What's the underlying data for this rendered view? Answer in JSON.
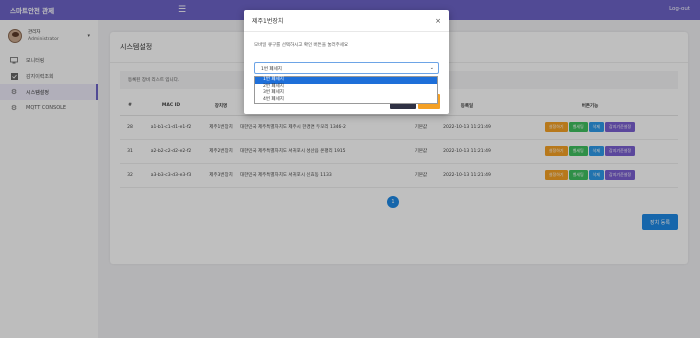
{
  "app": {
    "brand": "스마트안전 관제",
    "logout": "Log-out"
  },
  "user": {
    "name": "관리자",
    "role": "Administrator"
  },
  "sidebar": {
    "items": [
      {
        "label": "모니터링",
        "icon": "monitor-icon"
      },
      {
        "label": "감지이력조회",
        "icon": "checklist-icon"
      },
      {
        "label": "시스템설정",
        "icon": "gear-icon"
      },
      {
        "label": "MQTT CONSOLE",
        "icon": "gear-icon"
      }
    ]
  },
  "page": {
    "title": "시스템설정",
    "notice": "등록된 장비 리스트 입니다.",
    "headers": [
      "#",
      "MAC ID",
      "장치명",
      "",
      "등록일",
      "버튼기능"
    ],
    "rows": [
      {
        "num": "28",
        "mac": "a1-b1-c1-d1-e1-f2",
        "name": "제주1번장치",
        "addr": "대한민국 제주특별자치도 제주시 한경면 두모리 1346-2",
        "type": "기본값",
        "date": "2022-10-13 11:21:49"
      },
      {
        "num": "31",
        "mac": "a2-b2-c2-d2-e2-f2",
        "name": "제주2번장치",
        "addr": "대한민국 제주특별자치도 서귀포시 성산읍 온평리 1915",
        "type": "기본값",
        "date": "2022-10-13 11:21:49"
      },
      {
        "num": "32",
        "mac": "a3-b3-c3-d3-e3-f3",
        "name": "제주3번장치",
        "addr": "대한민국 제주특별자치도 서귀포시 신효동 1133",
        "type": "기본값",
        "date": "2022-10-13 11:21:49"
      }
    ],
    "row_buttons": {
      "settings": "설정하기",
      "bell": "벨세팅",
      "delete": "삭제",
      "sensor": "감지기준설정"
    },
    "pager_current": "1",
    "register_button": "장치 등록"
  },
  "modal": {
    "title": "제주1번장치",
    "close": "×",
    "message": "모바일 큐구를 선택하시고 확인 버튼을 눌러주세요",
    "select_value": "1번 폐세지",
    "options": [
      "1번 폐세지",
      "2번 폐세지",
      "3번 폐세지",
      "4번 폐세지"
    ]
  },
  "colors": {
    "accent": "#6c63c7",
    "primary": "#1e88e5",
    "orange": "#f4a024",
    "green": "#3fbf5f",
    "purple": "#7a5fd0"
  }
}
